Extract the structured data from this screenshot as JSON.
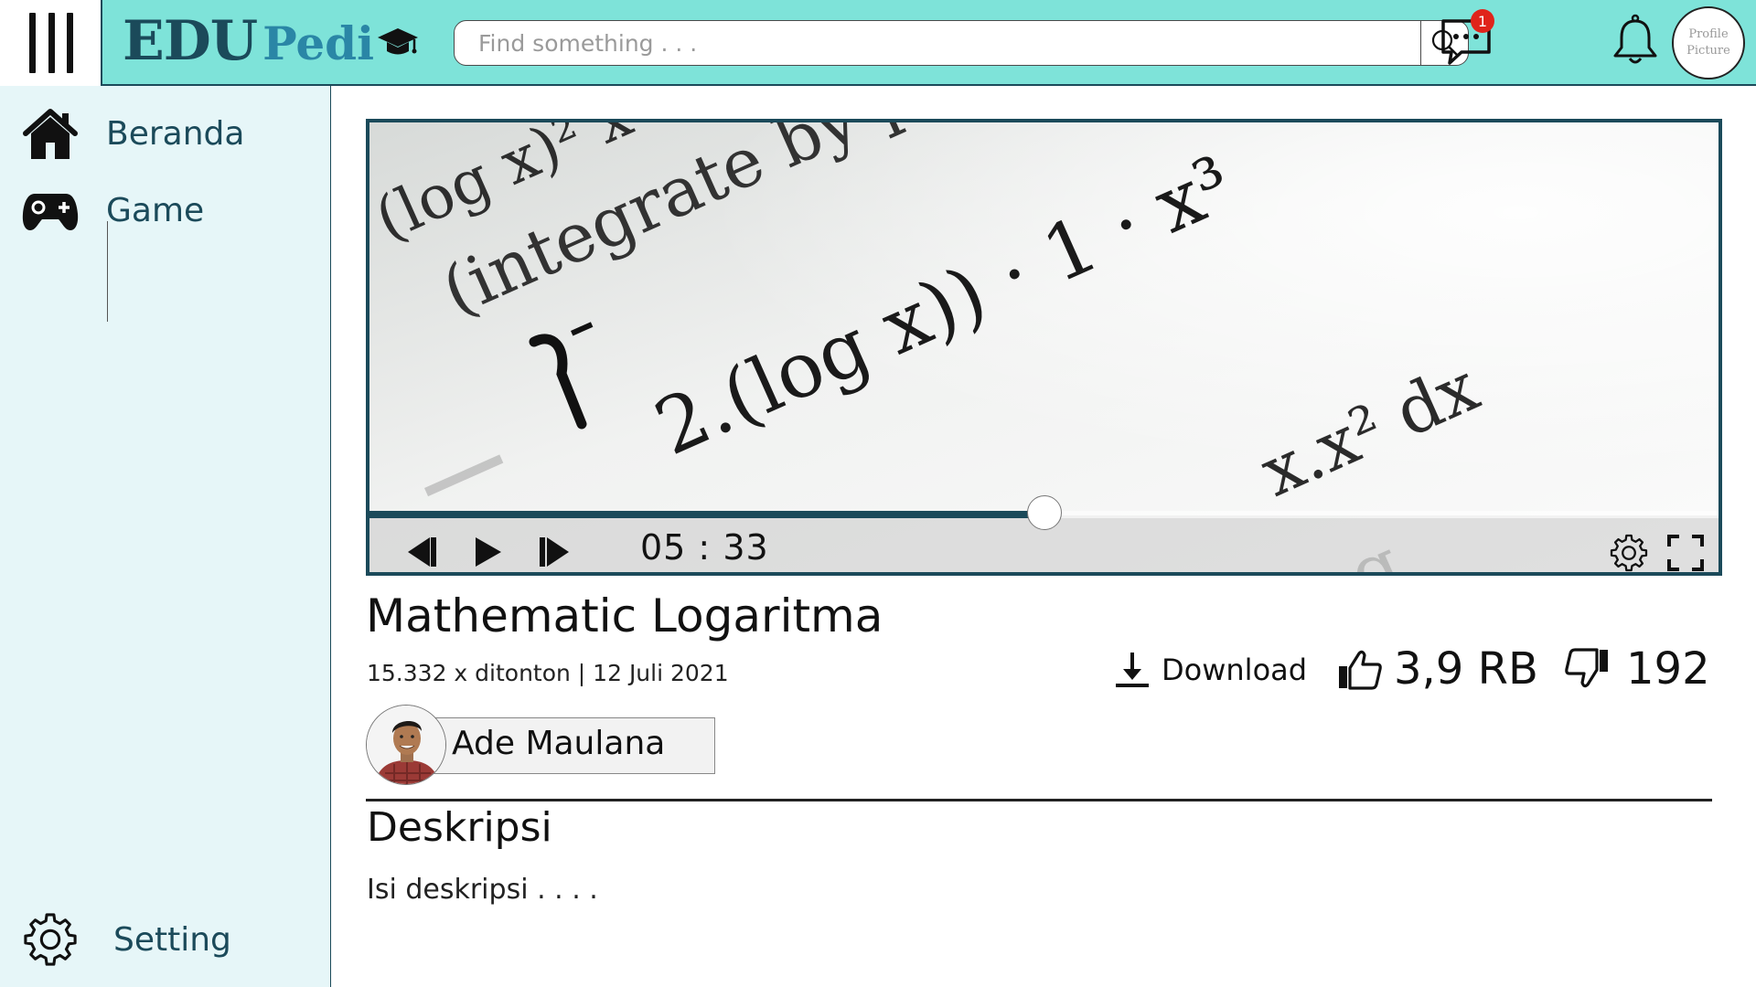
{
  "header": {
    "logo_edu": "EDU",
    "logo_pedi": "Pedi",
    "search_placeholder": "Find something . . .",
    "chat_badge": "1",
    "profile_line1": "Profile",
    "profile_line2": "Picture"
  },
  "sidebar": {
    "items": [
      {
        "label": "Beranda",
        "icon": "home-icon"
      },
      {
        "label": "Game",
        "icon": "gamepad-icon"
      }
    ],
    "setting_label": "Setting",
    "setting_icon": "gear-icon"
  },
  "player": {
    "time": "05 : 33",
    "progress": 0.5
  },
  "video": {
    "title": "Mathematic Logaritma",
    "meta": "15.332 x ditonton | 12 Juli 2021",
    "download_label": "Download",
    "likes": "3,9 RB",
    "dislikes": "192",
    "channel_name": "Ade Maulana"
  },
  "description": {
    "heading": "Deskripsi",
    "body": "Isi deskripsi . . . ."
  },
  "colors": {
    "header_bg": "#7ee3d9",
    "sidebar_bg": "#e6f6f8",
    "accent": "#1b4a5a",
    "logo_accent": "#2a86a6",
    "badge": "#e0241b"
  }
}
